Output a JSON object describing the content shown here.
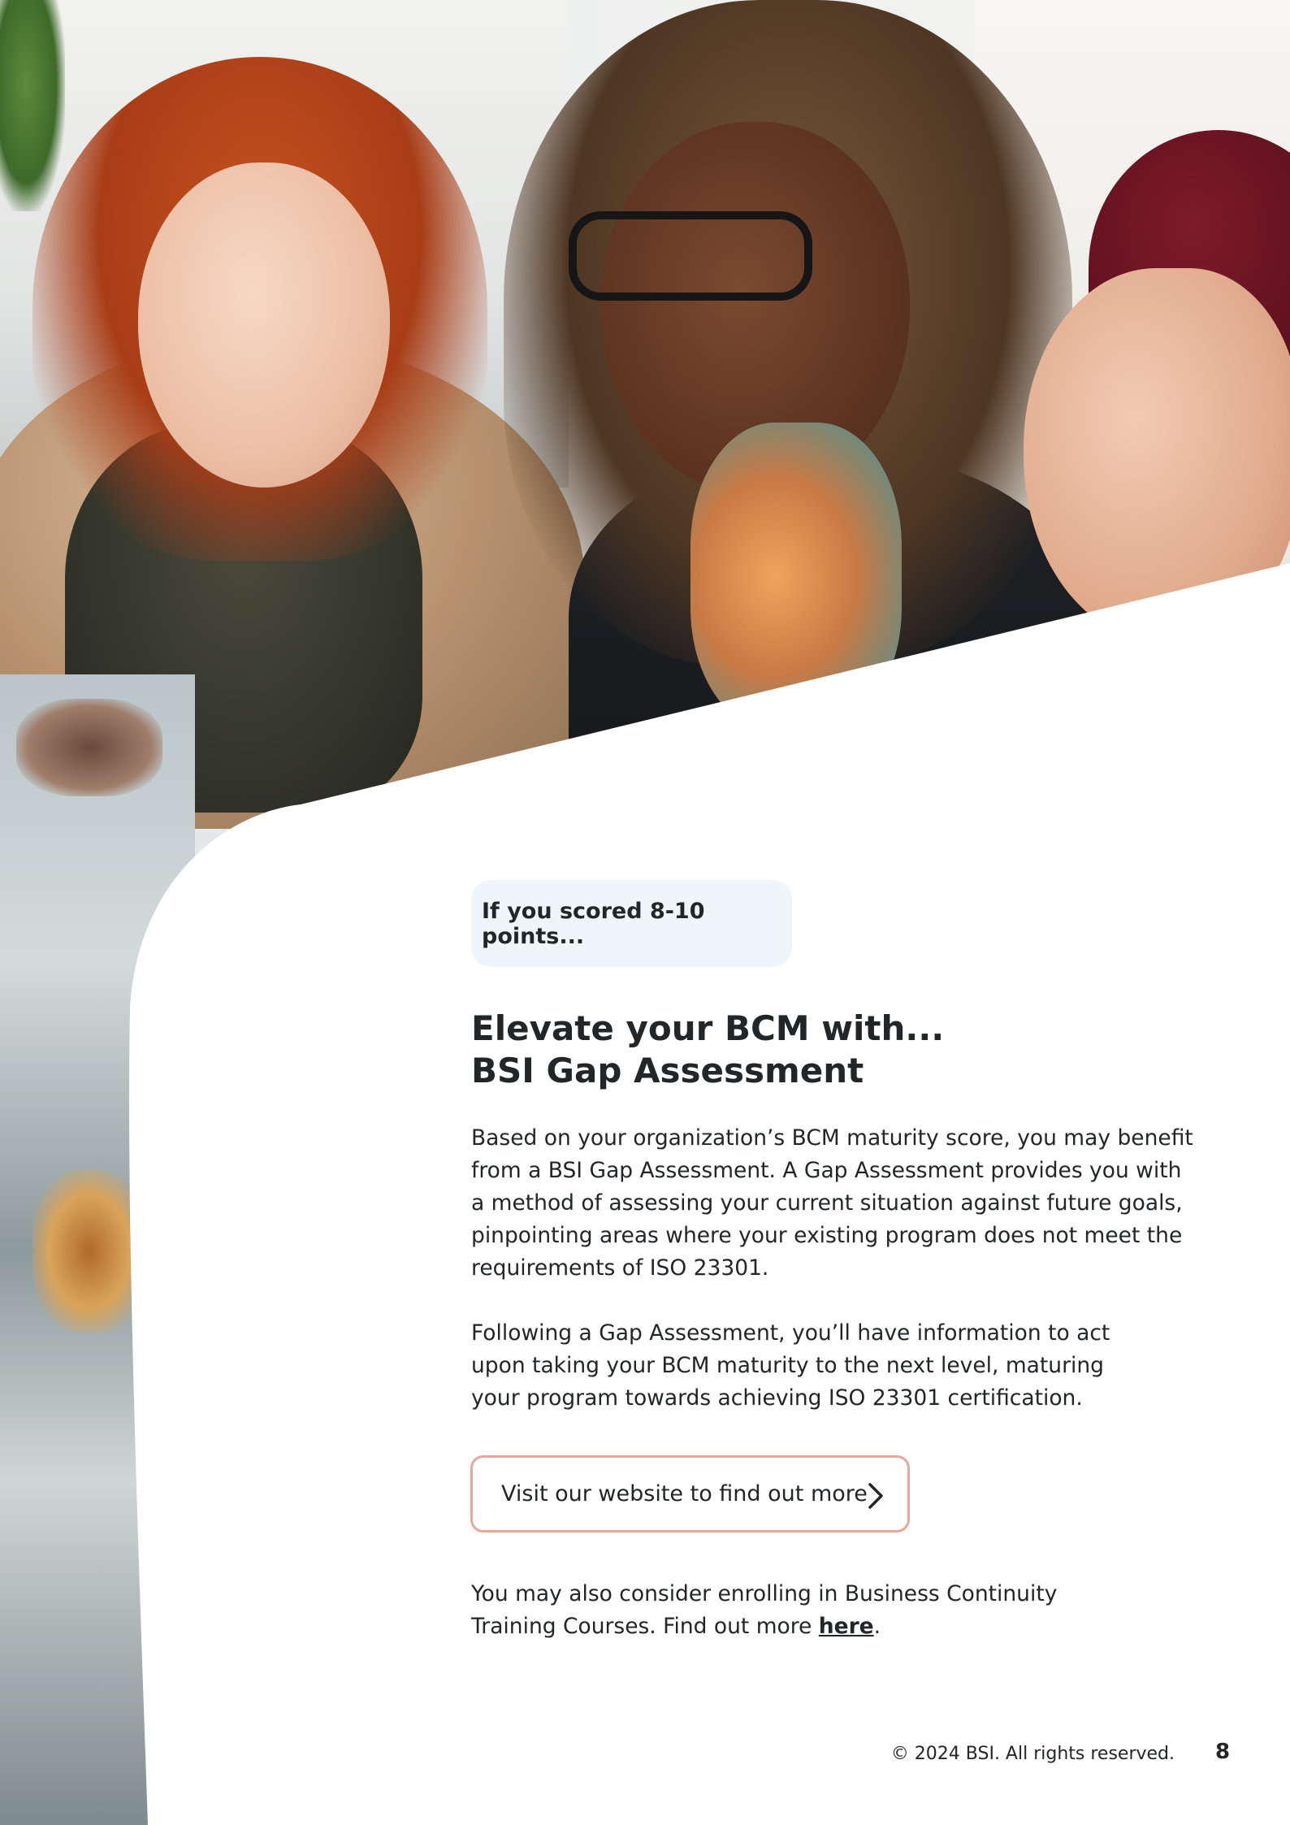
{
  "tag": {
    "text": "If you scored 8-10 points..."
  },
  "headline": {
    "line1": "Elevate your BCM with...",
    "line2": "BSI Gap Assessment"
  },
  "paragraph1": {
    "lines": [
      "Based on your organization’s BCM maturity score, you may benefit",
      "from a BSI Gap Assessment. A Gap Assessment provides you with",
      "a method of assessing your current situation against future goals,",
      "pinpointing areas where your existing program does not meet the",
      "requirements of ISO 23301."
    ]
  },
  "paragraph2": {
    "lines": [
      "Following a Gap Assessment, you’ll have information to act",
      "upon taking your BCM maturity to the next level, maturing",
      "your program towards achieving ISO 23301 certification."
    ]
  },
  "cta": {
    "label": "Visit our website to find out more",
    "icon": "chevron-right-icon",
    "border_color": "#e9a69b"
  },
  "paragraph3": {
    "line1": "You may also consider enrolling in Business Continuity",
    "line2_prefix": "Training Courses. Find out more ",
    "link_text": "here",
    "line2_suffix": "."
  },
  "footer": {
    "copyright": "© 2024 BSI. All rights reserved.",
    "page_number": "8"
  },
  "colors": {
    "text": "#222629",
    "tag_background": "#eff6fb",
    "accent": "#e9a69b"
  }
}
